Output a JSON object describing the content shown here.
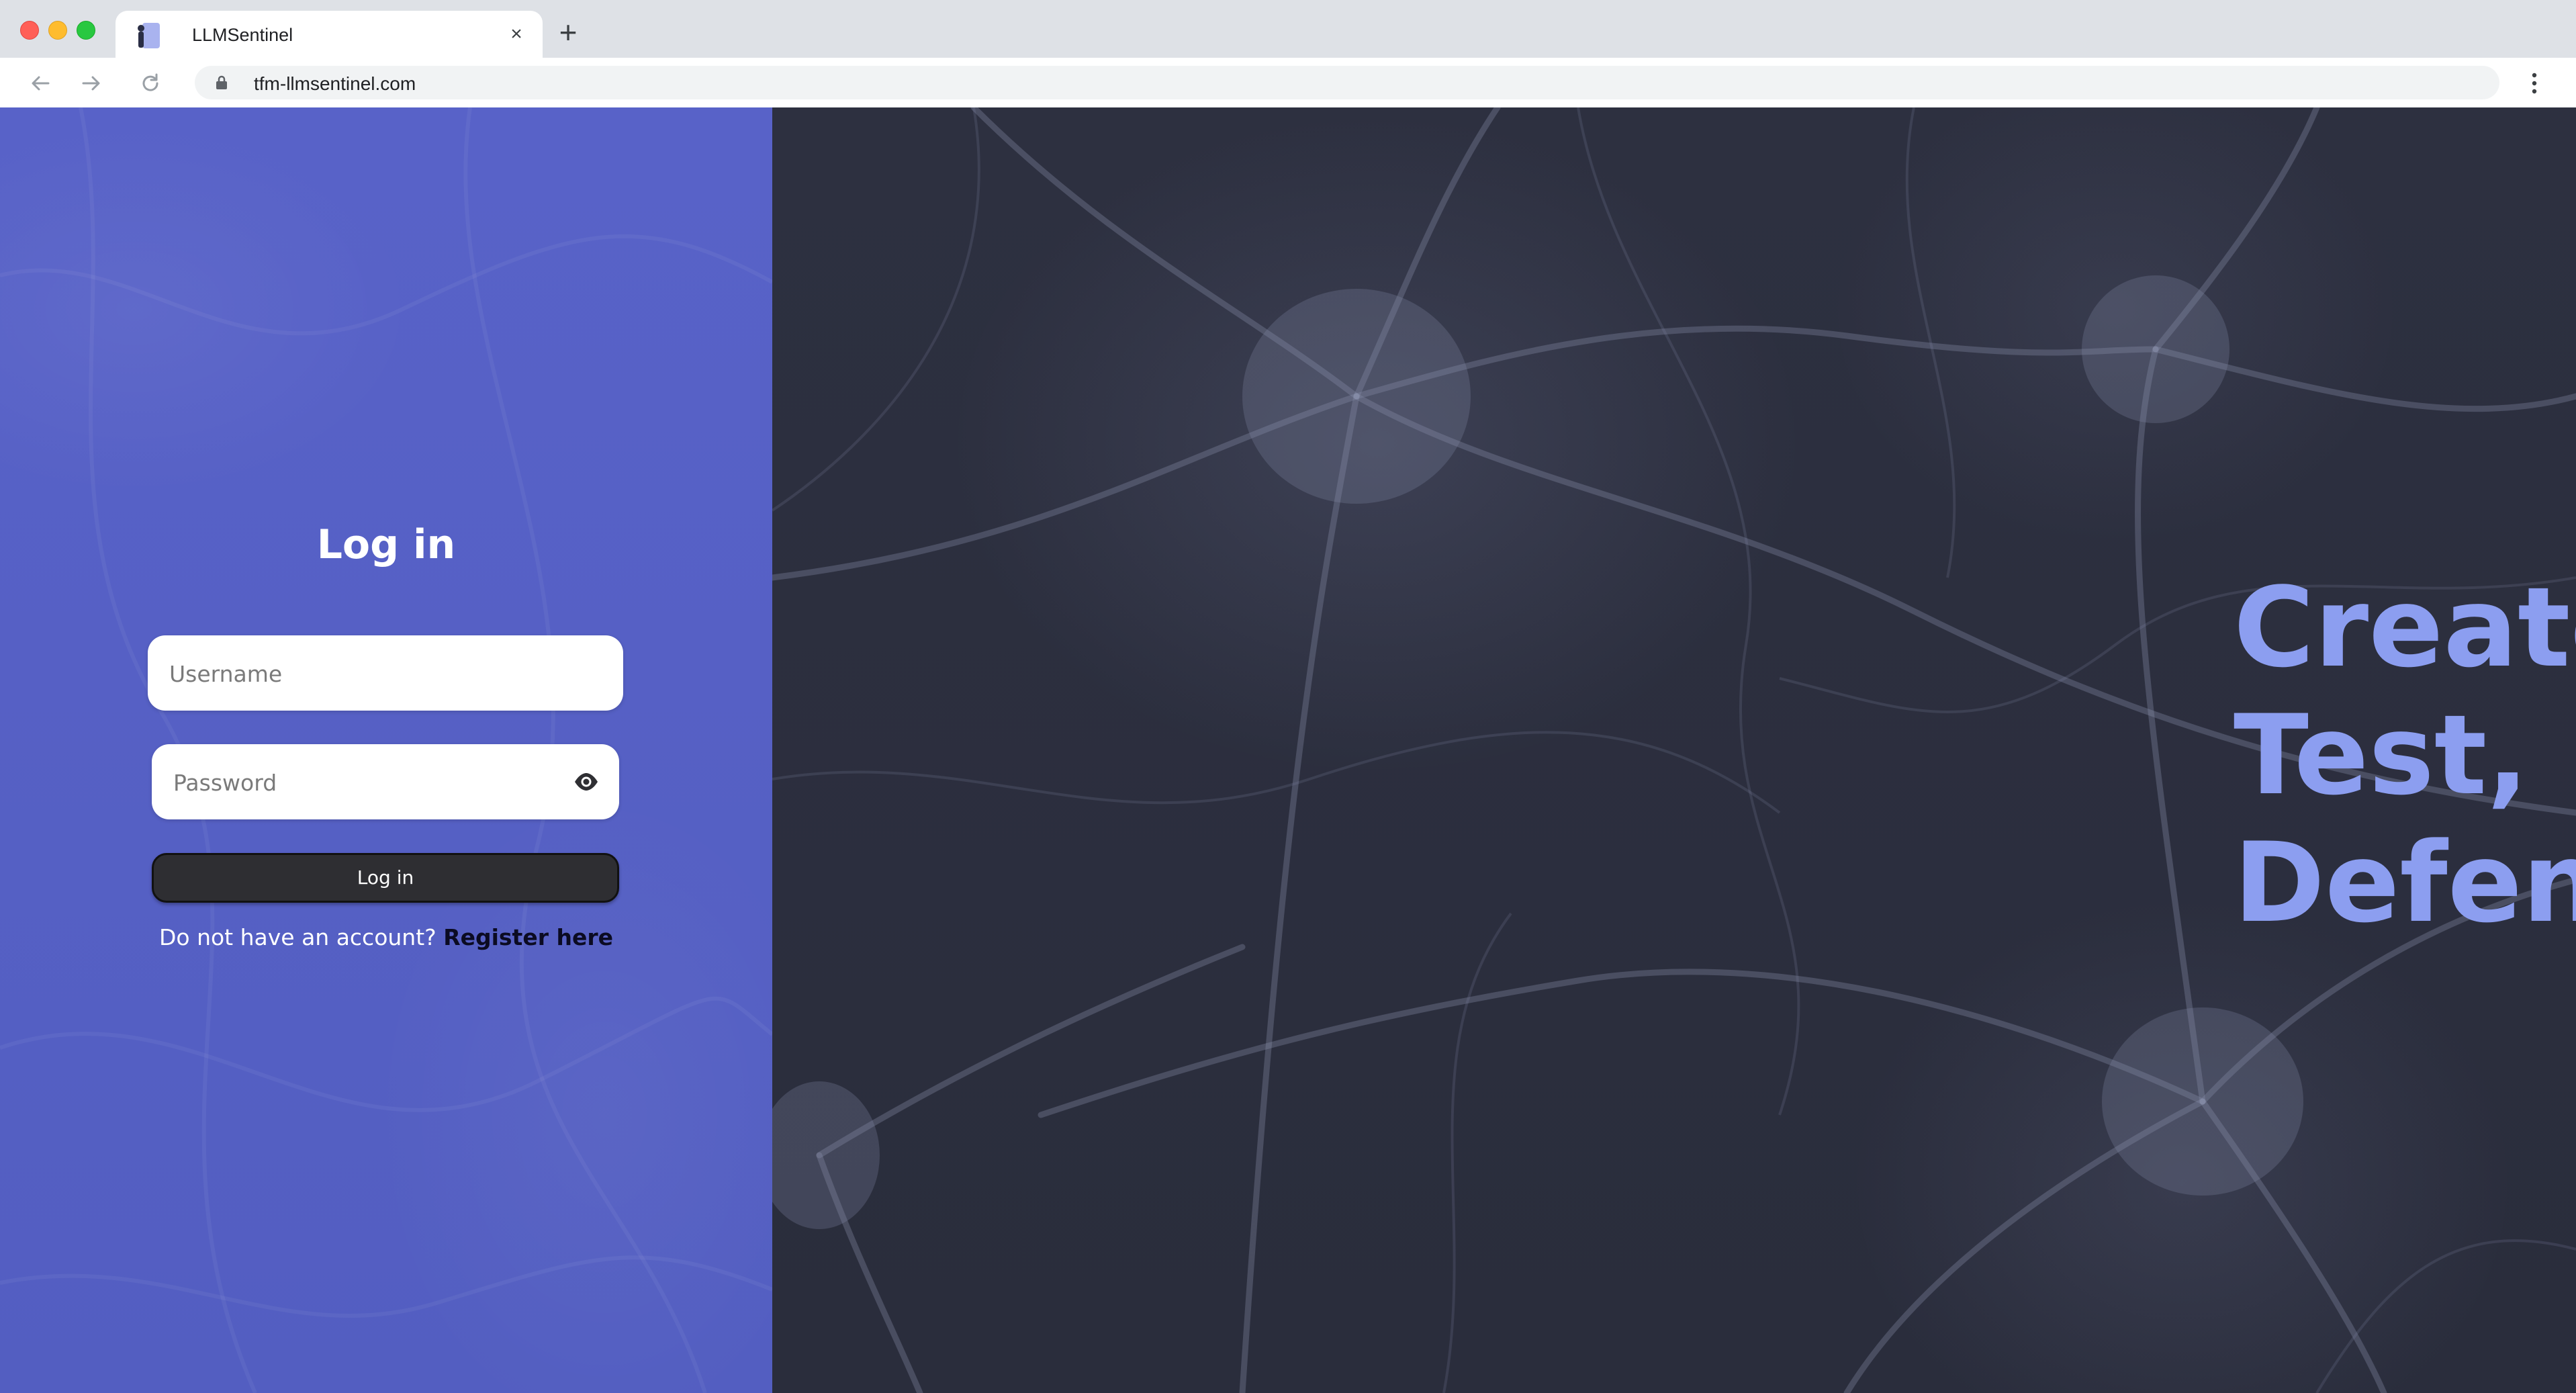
{
  "browser": {
    "tab_title": "LLMSentinel",
    "url": "tfm-llmsentinel.com",
    "new_tab_label": "+",
    "close_tab_label": "×"
  },
  "login": {
    "title": "Log in",
    "username_placeholder": "Username",
    "password_placeholder": "Password",
    "submit_label": "Log in",
    "account_question": "Do not have an account?",
    "register_link": "Register here"
  },
  "hero": {
    "lines": [
      "Create,",
      "Test,",
      "Defend."
    ]
  },
  "colors": {
    "left_panel": "#5560c4",
    "right_panel": "#2c2f3f",
    "slogan": "#8c9ef0",
    "button": "#2e2e32"
  }
}
